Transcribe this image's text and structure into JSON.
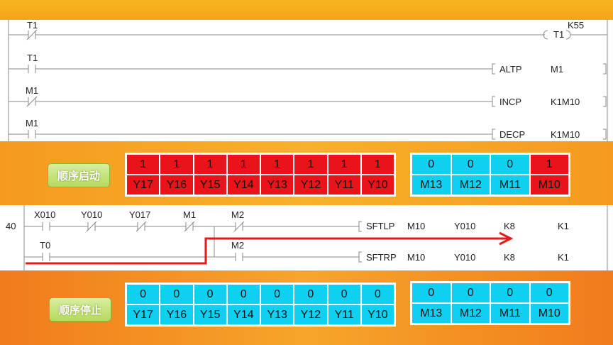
{
  "top_rungs": {
    "rung1": {
      "contact": "T1",
      "coil": "T1",
      "setting": "K55"
    },
    "rung2": {
      "contact": "T1",
      "instr": "ALTP",
      "op1": "M1"
    },
    "rung3": {
      "contact": "M1",
      "instr": "INCP",
      "op1": "K1M10"
    },
    "rung4": {
      "contact": "M1",
      "instr": "DECP",
      "op1": "K1M10"
    }
  },
  "start_section": {
    "button_label": "顺序启动",
    "y_values": [
      "1",
      "1",
      "1",
      "1",
      "1",
      "1",
      "1",
      "1"
    ],
    "y_labels": [
      "Y17",
      "Y16",
      "Y15",
      "Y14",
      "Y13",
      "Y12",
      "Y11",
      "Y10"
    ],
    "m_values": [
      "0",
      "0",
      "0",
      "1"
    ],
    "m_labels": [
      "M13",
      "M12",
      "M11",
      "M10"
    ]
  },
  "mid_rungs": {
    "step_number": "40",
    "contacts": [
      "X010",
      "Y010",
      "Y017",
      "M1",
      "M2"
    ],
    "lower_contact": "T0",
    "lower_m2": "M2",
    "sftlp": {
      "instr": "SFTLP",
      "a": "M10",
      "b": "Y010",
      "c": "K8",
      "d": "K1"
    },
    "sftrp": {
      "instr": "SFTRP",
      "a": "M10",
      "b": "Y010",
      "c": "K8",
      "d": "K1"
    }
  },
  "stop_section": {
    "button_label": "顺序停止",
    "y_values": [
      "0",
      "0",
      "0",
      "0",
      "0",
      "0",
      "0",
      "0"
    ],
    "y_labels": [
      "Y17",
      "Y16",
      "Y15",
      "Y14",
      "Y13",
      "Y12",
      "Y11",
      "Y10"
    ],
    "m_values": [
      "0",
      "0",
      "0",
      "0"
    ],
    "m_labels": [
      "M13",
      "M12",
      "M11",
      "M10"
    ]
  },
  "colors": {
    "active": "#e8141a",
    "inactive": "#0fd0f0",
    "arrow": "#e11a1a"
  }
}
